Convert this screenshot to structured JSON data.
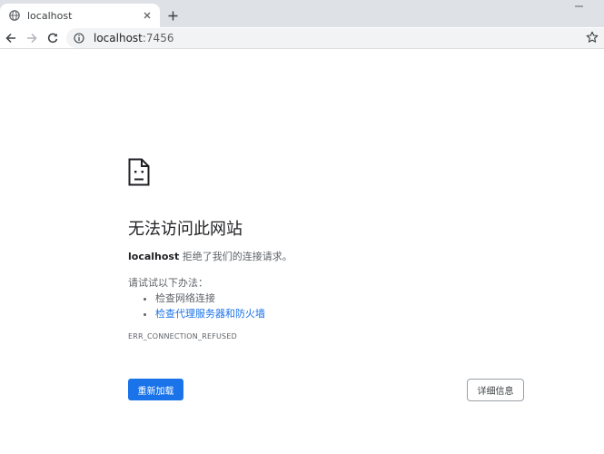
{
  "tab": {
    "title": "localhost"
  },
  "toolbar": {
    "url_host": "localhost",
    "url_port": ":7456"
  },
  "error": {
    "heading": "无法访问此网站",
    "host": "localhost",
    "message": " 拒绝了我们的连接请求。",
    "suggestions_title": "请试试以下办法：",
    "suggestions": [
      "检查网络连接",
      "检查代理服务器和防火墙"
    ],
    "code": "ERR_CONNECTION_REFUSED",
    "reload_label": "重新加载",
    "details_label": "详细信息"
  },
  "colors": {
    "accent": "#1a73e8",
    "tabstrip": "#dee1e6",
    "omnibox": "#f1f3f4"
  },
  "icons": {
    "favicon": "globe-icon",
    "tab_close": "close-icon",
    "new_tab": "plus-icon",
    "back": "arrow-left-icon",
    "forward": "arrow-right-icon",
    "reload": "reload-icon",
    "site_info": "info-icon",
    "bookmark": "star-icon",
    "error": "sad-page-icon"
  }
}
